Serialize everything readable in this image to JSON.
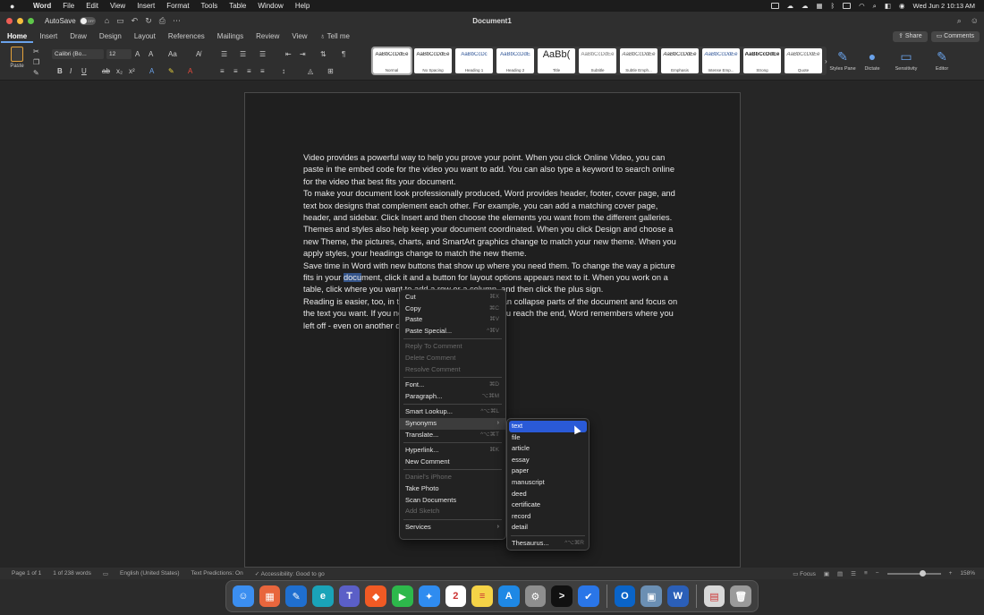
{
  "menubar": {
    "apple": "",
    "app": "Word",
    "items": [
      "File",
      "Edit",
      "View",
      "Insert",
      "Format",
      "Tools",
      "Table",
      "Window",
      "Help"
    ],
    "datetime": "Wed Jun 2  10:13 AM"
  },
  "window": {
    "title": "Document1",
    "autosave_label": "AutoSave",
    "autosave_state": "OFF"
  },
  "ribbon_tabs": [
    "Home",
    "Insert",
    "Draw",
    "Design",
    "Layout",
    "References",
    "Mailings",
    "Review",
    "View"
  ],
  "tell_me": "Tell me",
  "share_label": "Share",
  "comments_label": "Comments",
  "ribbon": {
    "paste_label": "Paste",
    "font_name": "Calibri (Bo...",
    "font_size": "12",
    "styles": [
      {
        "preview": "AaBbCcDdEe",
        "name": "Normal"
      },
      {
        "preview": "AaBbCcDdEe",
        "name": "No Spacing"
      },
      {
        "preview": "AaBbCcDc",
        "name": "Heading 1"
      },
      {
        "preview": "AaBbCcDdE",
        "name": "Heading 2"
      },
      {
        "preview": "AaBb(",
        "name": "Title"
      },
      {
        "preview": "AaBbCcDdEe",
        "name": "Subtitle"
      },
      {
        "preview": "AaBbCcDdEe",
        "name": "Subtle Emph..."
      },
      {
        "preview": "AaBbCcDdEe",
        "name": "Emphasis"
      },
      {
        "preview": "AaBbCcDdEe",
        "name": "Intense Emp..."
      },
      {
        "preview": "AaBbCcDdEe",
        "name": "Strong"
      },
      {
        "preview": "AaBbCcDdEe",
        "name": "Quote"
      }
    ],
    "styles_pane": "Styles Pane",
    "dictate": "Dictate",
    "sensitivity": "Sensitivity",
    "editor": "Editor"
  },
  "document": {
    "paragraphs": [
      "Video provides a powerful way to help you prove your point. When you click Online Video, you can paste in the embed code for the video you want to add. You can also type a keyword to search online for the video that best fits your document.",
      "To make your document look professionally produced, Word provides header, footer, cover page, and text box designs that complement each other. For example, you can add a matching cover page, header, and sidebar. Click Insert and then choose the elements you want from the different galleries.",
      "Themes and styles also help keep your document coordinated. When you click Design and choose a new Theme, the pictures, charts, and SmartArt graphics change to match your new theme. When you apply styles, your headings change to match the new theme."
    ],
    "p4_before": "Save time in Word with new buttons that show up where you need them. To change the way a picture fits in your ",
    "p4_highlight": "docu",
    "p4_after": "ment, click it and a button for layout options appears next to it. When you work on a table, click where you want to add a row or a column, and then click the plus sign.",
    "p5": "Reading is easier, too, in the new Reading view. You can collapse parts of the document and focus on the text you want. If you need to stop reading before you reach the end, Word remembers where you left off - even on another device."
  },
  "context_menu": {
    "groups": [
      [
        {
          "label": "Cut",
          "shortcut": "⌘X",
          "disabled": false
        },
        {
          "label": "Copy",
          "shortcut": "⌘C",
          "disabled": false
        },
        {
          "label": "Paste",
          "shortcut": "⌘V",
          "disabled": false
        },
        {
          "label": "Paste Special...",
          "shortcut": "^⌘V",
          "disabled": false
        }
      ],
      [
        {
          "label": "Reply To Comment",
          "shortcut": "",
          "disabled": true
        },
        {
          "label": "Delete Comment",
          "shortcut": "",
          "disabled": true
        },
        {
          "label": "Resolve Comment",
          "shortcut": "",
          "disabled": true
        }
      ],
      [
        {
          "label": "Font...",
          "shortcut": "⌘D",
          "disabled": false
        },
        {
          "label": "Paragraph...",
          "shortcut": "⌥⌘M",
          "disabled": false
        }
      ],
      [
        {
          "label": "Smart Lookup...",
          "shortcut": "^⌥⌘L",
          "disabled": false
        },
        {
          "label": "Synonyms",
          "shortcut": "",
          "disabled": false,
          "submenu": true,
          "active": true
        },
        {
          "label": "Translate...",
          "shortcut": "^⌥⌘T",
          "disabled": false
        }
      ],
      [
        {
          "label": "Hyperlink...",
          "shortcut": "⌘K",
          "disabled": false
        },
        {
          "label": "New Comment",
          "shortcut": "",
          "disabled": false
        }
      ],
      [
        {
          "label": "Daniel's iPhone",
          "shortcut": "",
          "disabled": true
        },
        {
          "label": "Take Photo",
          "shortcut": "",
          "disabled": false
        },
        {
          "label": "Scan Documents",
          "shortcut": "",
          "disabled": false
        },
        {
          "label": "Add Sketch",
          "shortcut": "",
          "disabled": true
        }
      ],
      [
        {
          "label": "Services",
          "shortcut": "",
          "disabled": false,
          "submenu": true
        }
      ]
    ]
  },
  "synonyms_menu": {
    "items": [
      "text",
      "file",
      "article",
      "essay",
      "paper",
      "manuscript",
      "deed",
      "certificate",
      "record",
      "detail"
    ],
    "selected": "text",
    "thesaurus_label": "Thesaurus...",
    "thesaurus_shortcut": "^⌥⌘R"
  },
  "statusbar": {
    "page": "Page 1 of 1",
    "words": "1 of 238 words",
    "language": "English (United States)",
    "predictions": "Text Predictions: On",
    "accessibility": "Accessibility: Good to go",
    "focus": "Focus",
    "zoom": "158%"
  },
  "dock": {
    "apps": [
      {
        "icon": "finder-icon",
        "color": "#3b8ef0",
        "glyph": "☺"
      },
      {
        "icon": "launchpad-icon",
        "color": "#e8663d",
        "glyph": "▦"
      },
      {
        "icon": "xcode-icon",
        "color": "#1f6fd0",
        "glyph": "✎"
      },
      {
        "icon": "edge-icon",
        "color": "#1aa3b8",
        "glyph": "e"
      },
      {
        "icon": "teams-icon",
        "color": "#5b5fc7",
        "glyph": "T"
      },
      {
        "icon": "brave-icon",
        "color": "#f15a24",
        "glyph": "◆"
      },
      {
        "icon": "facetime-icon",
        "color": "#2db84b",
        "glyph": "▶"
      },
      {
        "icon": "safari-icon",
        "color": "#2f8cf0",
        "glyph": "✦"
      },
      {
        "icon": "calendar-icon",
        "color": "#ffffff",
        "glyph": "2"
      },
      {
        "icon": "notes-icon",
        "color": "#f5d347",
        "glyph": "≡"
      },
      {
        "icon": "appstore-icon",
        "color": "#1e88e5",
        "glyph": "A"
      },
      {
        "icon": "settings-icon",
        "color": "#8e8e8e",
        "glyph": "⚙"
      },
      {
        "icon": "terminal-icon",
        "color": "#111111",
        "glyph": ">"
      },
      {
        "icon": "todo-icon",
        "color": "#2a76e8",
        "glyph": "✔"
      },
      {
        "icon": "outlook-icon",
        "color": "#0a64c8",
        "glyph": "O"
      },
      {
        "icon": "preview-icon",
        "color": "#6b8fb3",
        "glyph": "▣"
      },
      {
        "icon": "word-icon",
        "color": "#2b5fb8",
        "glyph": "W"
      },
      {
        "icon": "files-icon",
        "color": "#d8d8d8",
        "glyph": "▤"
      },
      {
        "icon": "trash-icon",
        "color": "#9a9a9a",
        "glyph": "🗑"
      }
    ]
  }
}
